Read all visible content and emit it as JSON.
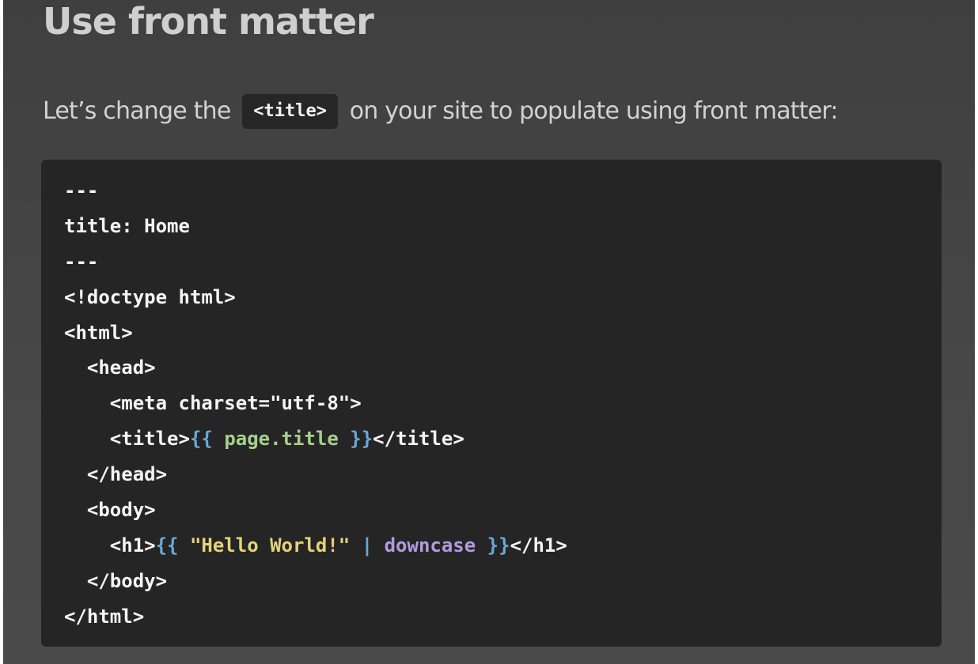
{
  "section": {
    "heading": "Use front matter",
    "intro_before": "Let’s change the",
    "intro_code": "<title>",
    "intro_after": "on your site to populate using front matter:"
  },
  "code": {
    "lines": [
      "---",
      "title: Home",
      "---",
      "<!doctype html>",
      "<html>",
      "  <head>",
      "    <meta charset=\"utf-8\">",
      "    <title>{{ page.title }}</title>",
      "  </head>",
      "  <body>",
      "    <h1>{{ \"Hello World!\" | downcase }}</h1>",
      "  </body>",
      "</html>"
    ],
    "tokens": {
      "title_open": "    <title>",
      "title_brace_open": "{{ ",
      "title_var": "page.title",
      "title_brace_close": " }}",
      "title_close": "</title>",
      "h1_open": "    <h1>",
      "h1_brace_open": "{{ ",
      "h1_string": "\"Hello World!\"",
      "h1_pipe": " | ",
      "h1_filter": "downcase",
      "h1_brace_close": " }}",
      "h1_close": "</h1>"
    }
  },
  "colors": {
    "page_background": "#454545",
    "code_background": "#252525",
    "liquid_brace": "#6aa9d6",
    "liquid_variable": "#a6d18c",
    "liquid_string": "#e5d37a",
    "liquid_filter": "#b39be0"
  }
}
